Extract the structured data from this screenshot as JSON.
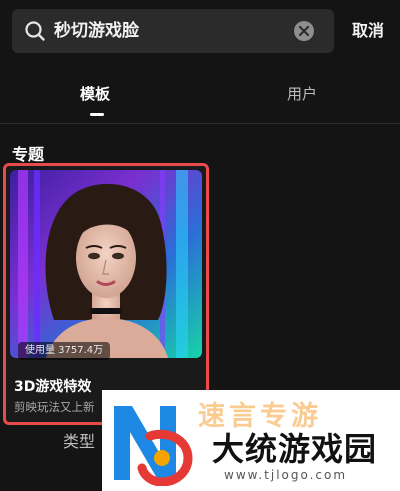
{
  "search": {
    "query": "秒切游戏脸",
    "cancel_label": "取消"
  },
  "tabs": [
    {
      "label": "模板"
    },
    {
      "label": "用户"
    }
  ],
  "section": {
    "title": "专题"
  },
  "card": {
    "usage": "使用量 3757.4万",
    "title": "3D游戏特效",
    "description": "剪映玩法又上新"
  },
  "bottom": {
    "type_label": "类型"
  },
  "watermark": {
    "slogan": "速言专游",
    "name": "大统游戏园",
    "url": "www.tjlogo.com"
  },
  "colors": {
    "background": "#141414",
    "highlight_border": "#e84b4b",
    "search_bg": "#2b2b2b"
  }
}
